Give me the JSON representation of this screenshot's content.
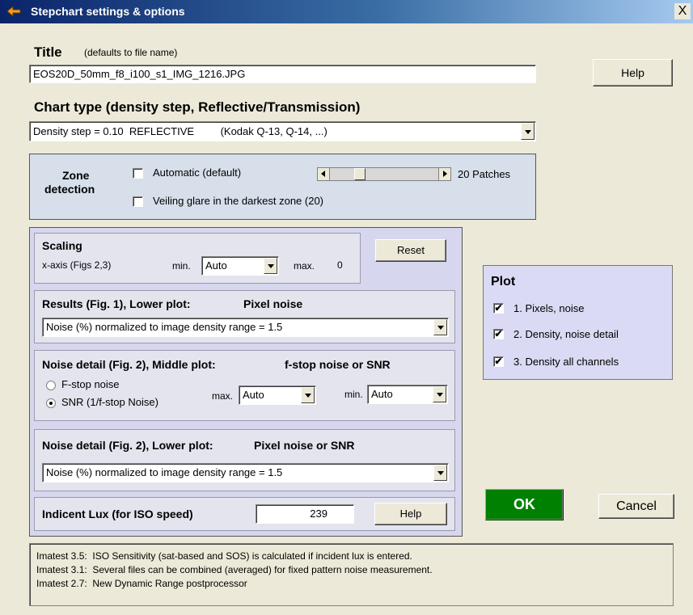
{
  "window": {
    "title": "Stepchart settings & options",
    "close_glyph": "X"
  },
  "title_section": {
    "label": "Title",
    "hint": "(defaults to file name)",
    "value": "EOS20D_50mm_f8_i100_s1_IMG_1216.JPG",
    "help_label": "Help"
  },
  "chart_type": {
    "label": "Chart type (density step, Reflective/Transmission)",
    "selected": "Density step = 0.10  REFLECTIVE         (Kodak Q-13, Q-14, ...)"
  },
  "zone": {
    "label_line1": "Zone",
    "label_line2": "detection",
    "automatic_label": "Automatic (default)",
    "automatic_checked": false,
    "veiling_label": "Veiling glare in the darkest zone (20)",
    "veiling_checked": false,
    "patches_label": "20 Patches",
    "slider_level": 0.25
  },
  "scaling": {
    "heading": "Scaling",
    "xaxis_label": "x-axis (Figs 2,3)",
    "min_label": "min.",
    "min_value": "Auto",
    "max_label": "max.",
    "max_value": "0",
    "reset_label": "Reset"
  },
  "results": {
    "heading": "Results (Fig. 1), Lower plot:",
    "heading_value": "Pixel noise",
    "selected": "Noise (%) normalized to image density range = 1.5"
  },
  "noise_middle": {
    "heading": "Noise detail (Fig. 2), Middle plot:",
    "heading_value": "f-stop noise or SNR",
    "opt_fstop": "F-stop noise",
    "opt_snr": "SNR (1/f-stop Noise)",
    "selected_option": "SNR (1/f-stop Noise)",
    "max_label": "max.",
    "max_value": "Auto",
    "min_label": "min.",
    "min_value": "Auto"
  },
  "noise_lower": {
    "heading": "Noise detail (Fig. 2), Lower plot:",
    "heading_value": "Pixel noise or SNR",
    "selected": "Noise (%) normalized to image density range = 1.5"
  },
  "lux": {
    "label": "Indicent Lux (for ISO speed)",
    "value": "239",
    "help_label": "Help"
  },
  "plot": {
    "heading": "Plot",
    "items": [
      {
        "label": "1. Pixels, noise",
        "checked": true
      },
      {
        "label": "2. Density, noise detail",
        "checked": true
      },
      {
        "label": "3. Density all channels",
        "checked": true
      }
    ]
  },
  "actions": {
    "ok_label": "OK",
    "cancel_label": "Cancel"
  },
  "notes": [
    "Imatest 3.5:  ISO Sensitivity (sat-based and SOS) is calculated if incident lux is entered.",
    "Imatest 3.1:  Several files can be combined (averaged) for fixed pattern noise measurement.",
    "Imatest 2.7:  New Dynamic Range postprocessor"
  ],
  "check_glyph": "✔",
  "colors": {
    "ok_button": "#008000",
    "panel_bg": "#d6d6ee",
    "plot_bg": "#dadaf4"
  }
}
